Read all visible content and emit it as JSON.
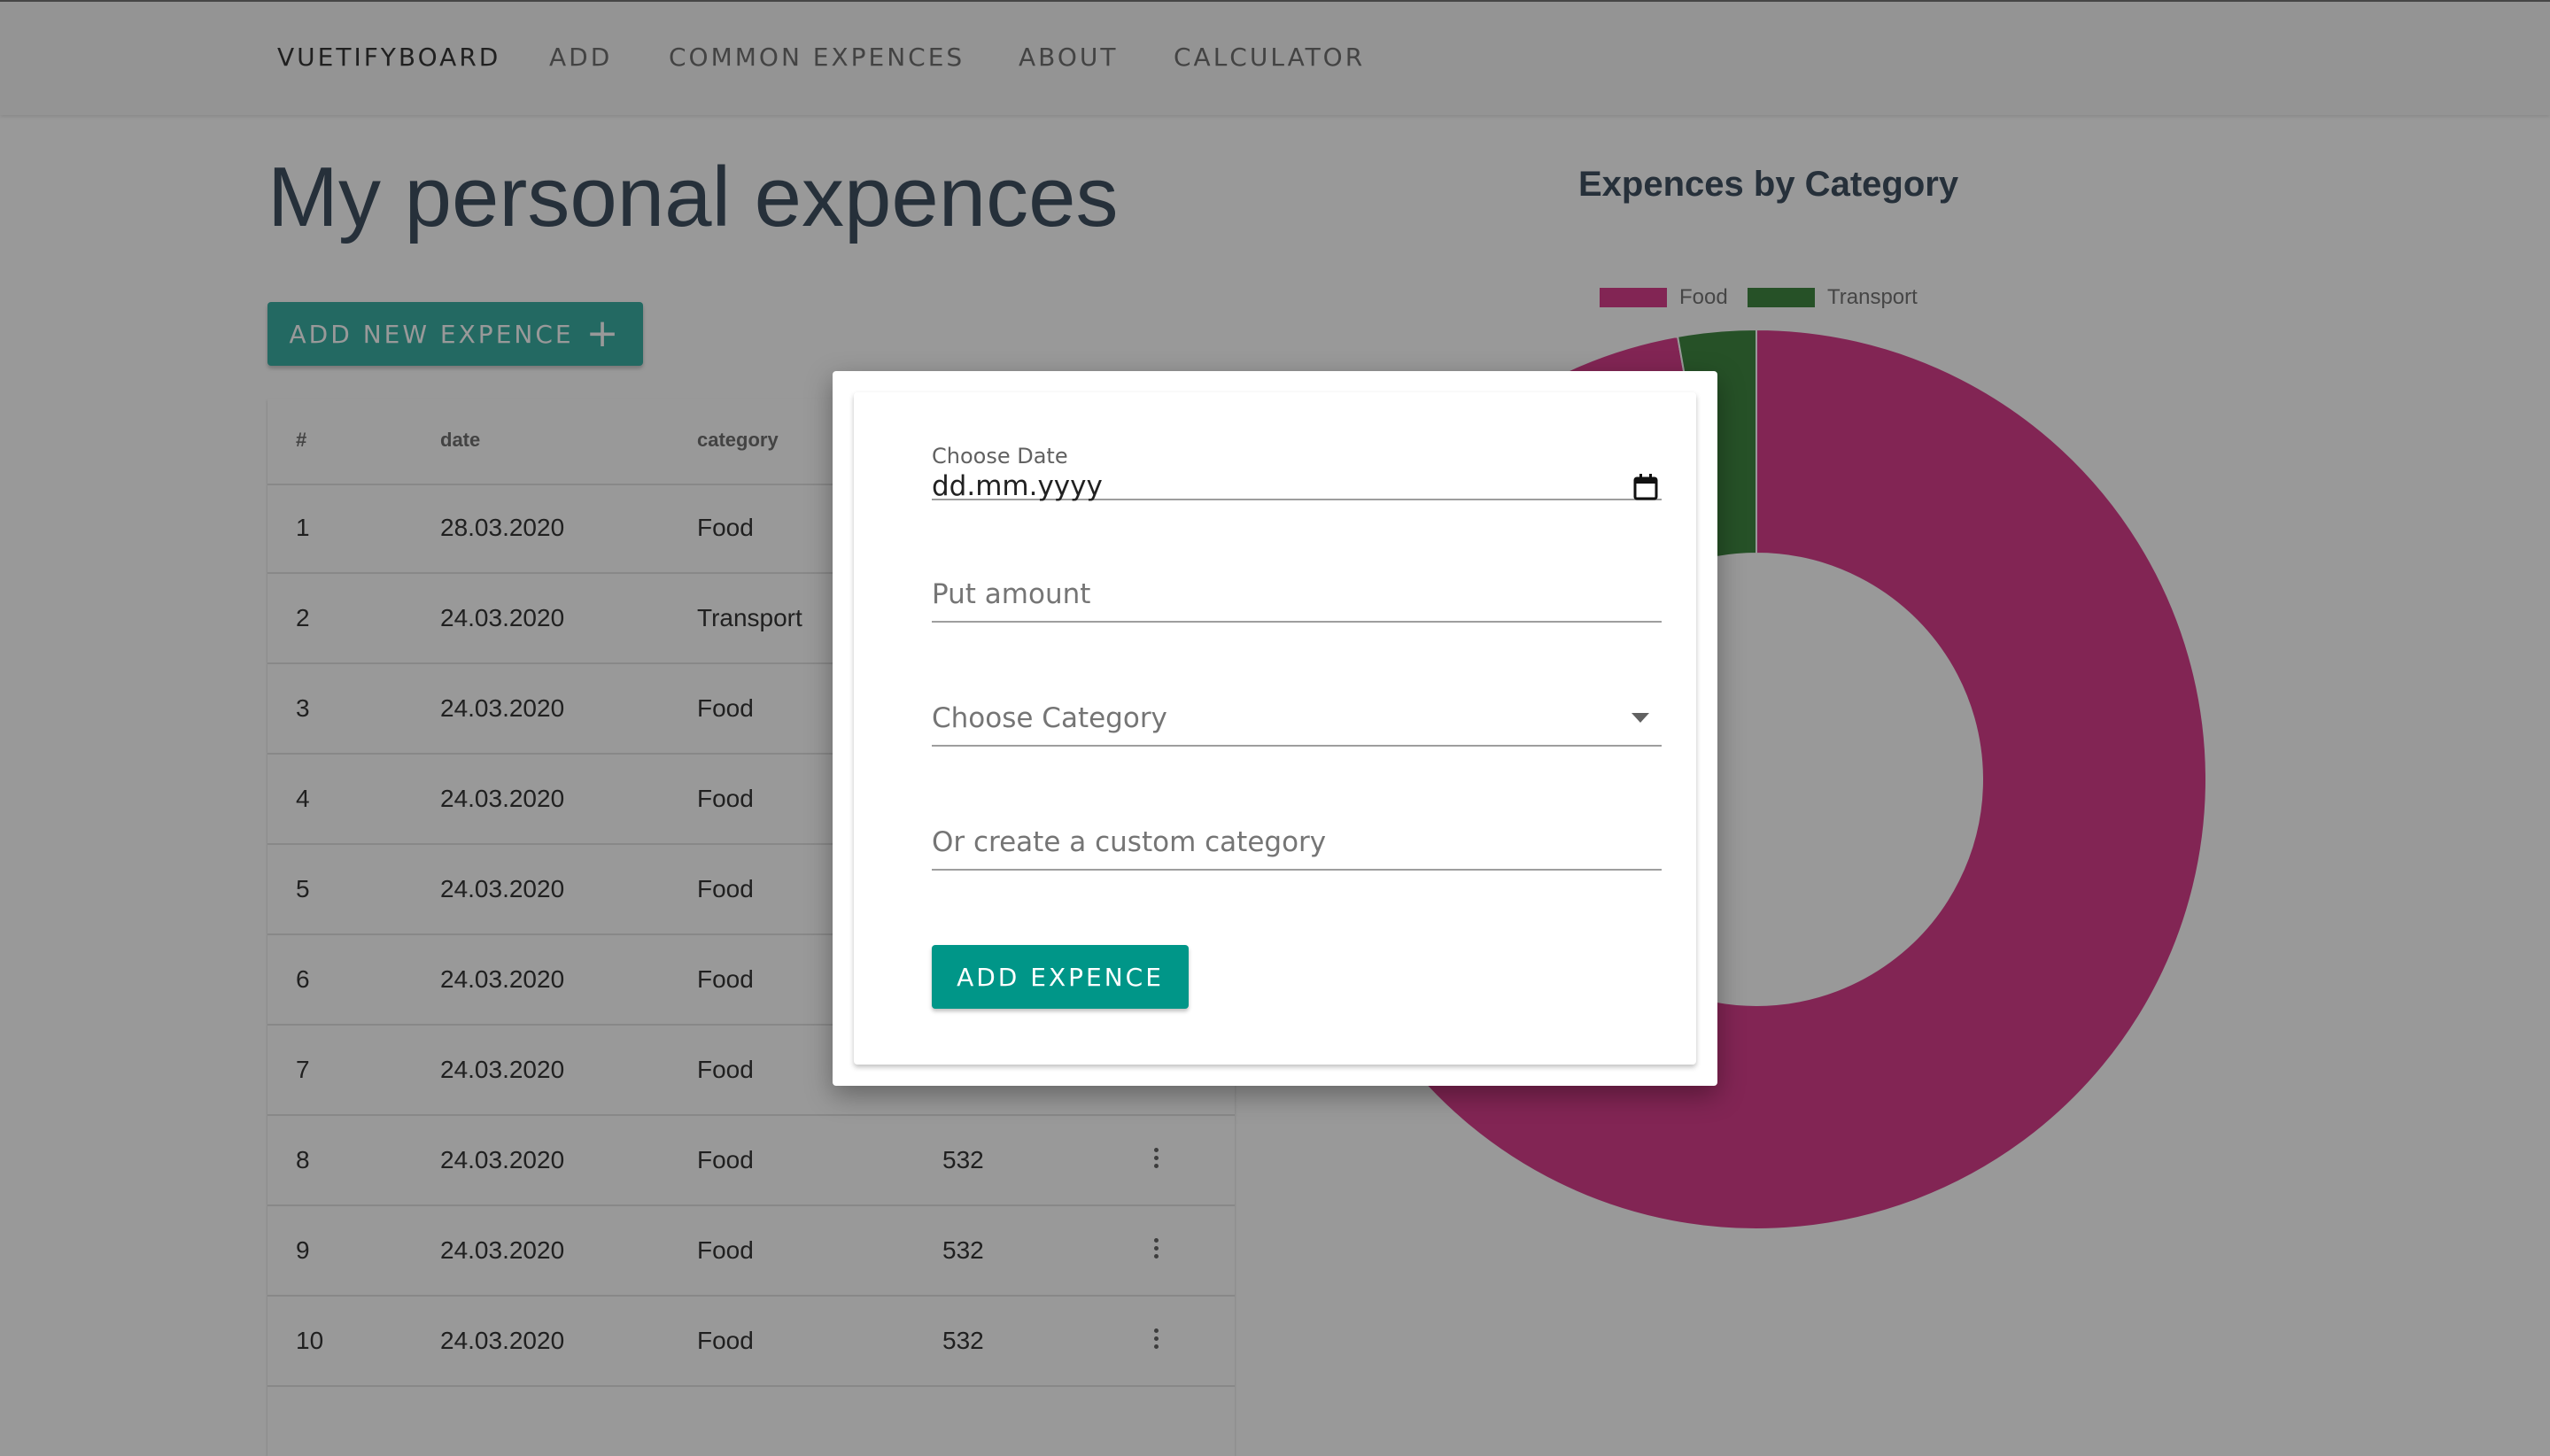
{
  "nav": {
    "brand": "VUETIFYBOARD",
    "items": [
      "ADD",
      "COMMON EXPENCES",
      "ABOUT",
      "CALCULATOR"
    ]
  },
  "page_title": "My personal expences",
  "add_button_label": "ADD NEW EXPENCE",
  "table": {
    "headers": [
      "#",
      "date",
      "category"
    ],
    "rows": [
      {
        "num": "1",
        "date": "28.03.2020",
        "category": "Food",
        "amount": ""
      },
      {
        "num": "2",
        "date": "24.03.2020",
        "category": "Transport",
        "amount": ""
      },
      {
        "num": "3",
        "date": "24.03.2020",
        "category": "Food",
        "amount": ""
      },
      {
        "num": "4",
        "date": "24.03.2020",
        "category": "Food",
        "amount": ""
      },
      {
        "num": "5",
        "date": "24.03.2020",
        "category": "Food",
        "amount": ""
      },
      {
        "num": "6",
        "date": "24.03.2020",
        "category": "Food",
        "amount": ""
      },
      {
        "num": "7",
        "date": "24.03.2020",
        "category": "Food",
        "amount": ""
      },
      {
        "num": "8",
        "date": "24.03.2020",
        "category": "Food",
        "amount": "532"
      },
      {
        "num": "9",
        "date": "24.03.2020",
        "category": "Food",
        "amount": "532"
      },
      {
        "num": "10",
        "date": "24.03.2020",
        "category": "Food",
        "amount": "532"
      }
    ]
  },
  "chart": {
    "title": "Expences by Category",
    "legend": [
      {
        "label": "Food",
        "color": "#d42a80"
      },
      {
        "label": "Transport",
        "color": "#2c7a2e"
      }
    ]
  },
  "chart_data": {
    "type": "pie",
    "categories": [
      "Food",
      "Transport"
    ],
    "values": [
      97.2,
      2.8
    ],
    "colors": [
      "#d42a80",
      "#2c7a2e"
    ],
    "legend_position": "top"
  },
  "dialog": {
    "date_label": "Choose Date",
    "date_value": "dd.mm.yyyy",
    "amount_placeholder": "Put amount",
    "category_placeholder": "Choose Category",
    "custom_category_placeholder": "Or create a custom category",
    "submit_label": "ADD EXPENCE"
  }
}
